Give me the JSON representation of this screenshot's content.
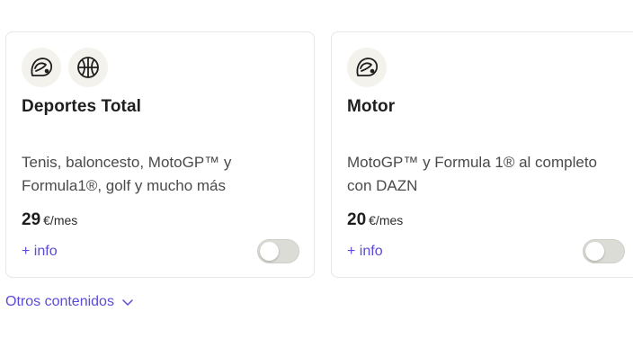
{
  "cards": [
    {
      "icons": [
        "helmet-icon",
        "basketball-icon"
      ],
      "title": "Deportes Total",
      "description": "Tenis, baloncesto, MotoGP™ y Formula1®, golf y mucho más",
      "price_amount": "29",
      "price_unit": "€/mes",
      "info_label": "+ info",
      "toggle_on": false
    },
    {
      "icons": [
        "helmet-icon"
      ],
      "title": "Motor",
      "description": "MotoGP™ y Formula 1® al completo con DAZN",
      "price_amount": "20",
      "price_unit": "€/mes",
      "info_label": "+ info",
      "toggle_on": false
    }
  ],
  "more_contents_label": "Otros contenidos",
  "colors": {
    "accent": "#5b4bd6",
    "toggle_off": "#dcdcd6",
    "icon_bg": "#f3f2ec"
  }
}
